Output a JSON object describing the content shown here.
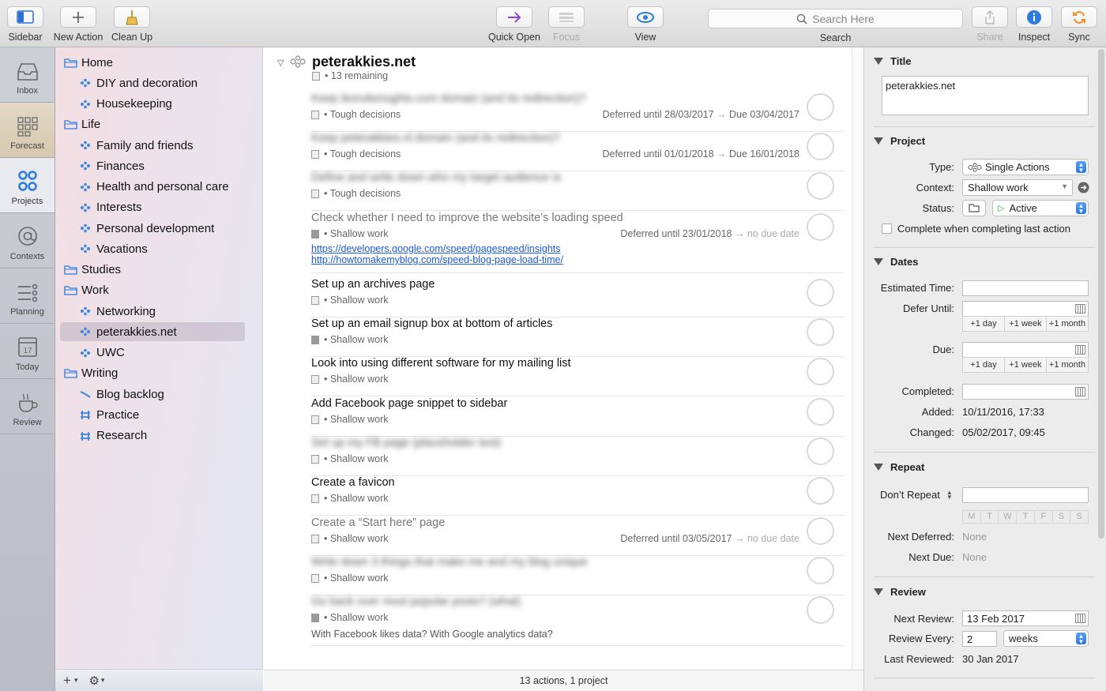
{
  "toolbar": {
    "sidebar": "Sidebar",
    "new_action": "New Action",
    "clean_up": "Clean Up",
    "quick_open": "Quick Open",
    "focus": "Focus",
    "view": "View",
    "search_placeholder": "Search Here",
    "search": "Search",
    "share": "Share",
    "inspect": "Inspect",
    "sync": "Sync"
  },
  "rail": [
    "Inbox",
    "Forecast",
    "Projects",
    "Contexts",
    "Planning",
    "Today",
    "Review"
  ],
  "today_day": "17",
  "sidebar": {
    "items": [
      {
        "label": "Home",
        "kind": "folder"
      },
      {
        "label": "DIY and decoration",
        "kind": "project"
      },
      {
        "label": "Housekeeping",
        "kind": "project"
      },
      {
        "label": "Life",
        "kind": "folder"
      },
      {
        "label": "Family and friends",
        "kind": "project"
      },
      {
        "label": "Finances",
        "kind": "project"
      },
      {
        "label": "Health and personal care",
        "kind": "project"
      },
      {
        "label": "Interests",
        "kind": "project"
      },
      {
        "label": "Personal development",
        "kind": "project"
      },
      {
        "label": "Vacations",
        "kind": "project"
      },
      {
        "label": "Studies",
        "kind": "folder"
      },
      {
        "label": "Work",
        "kind": "folder"
      },
      {
        "label": "Networking",
        "kind": "project"
      },
      {
        "label": "peterakkies.net",
        "kind": "project"
      },
      {
        "label": "UWC",
        "kind": "project"
      },
      {
        "label": "Writing",
        "kind": "folder"
      },
      {
        "label": "Blog backlog",
        "kind": "sequential"
      },
      {
        "label": "Practice",
        "kind": "parallel"
      },
      {
        "label": "Research",
        "kind": "parallel"
      }
    ],
    "bottom_add": "+",
    "bottom_gear": "⚙"
  },
  "project": {
    "title": "peterakkies.net",
    "remaining": "• 13 remaining"
  },
  "actions": [
    {
      "title": "Keep ikoruitonughts.com domain (and its redirection)?",
      "context": "• Tough decisions",
      "deferred": "Deferred until 28/03/2017",
      "due": "Due 03/04/2017"
    },
    {
      "title": "Keep peterakkies.nl domain (and its redirection)?",
      "context": "• Tough decisions",
      "deferred": "Deferred until 01/01/2018",
      "due": "Due 16/01/2018"
    },
    {
      "title": "Define and write down who my target audience is",
      "context": "• Tough decisions"
    },
    {
      "title": "Check whether I need to improve the website’s loading speed",
      "context": "• Shallow work",
      "deferred": "Deferred until 23/01/2018",
      "due": "no due date",
      "links": [
        "https://developers.google.com/speed/pagespeed/insights",
        "http://howtomakemyblog.com/speed-blog-page-load-time/"
      ]
    },
    {
      "title": "Set up an archives page",
      "context": "• Shallow work"
    },
    {
      "title": "Set up an email signup box at bottom of articles",
      "context": "• Shallow work"
    },
    {
      "title": "Look into using different software for my mailing list",
      "context": "• Shallow work"
    },
    {
      "title": "Add Facebook page snippet to sidebar",
      "context": "• Shallow work"
    },
    {
      "title": "Set up my FB page (placeholder text)",
      "context": "• Shallow work"
    },
    {
      "title": "Create a favicon",
      "context": "• Shallow work"
    },
    {
      "title": "Create a “Start here” page",
      "context": "• Shallow work",
      "deferred": "Deferred until 03/05/2017",
      "due": "no due date"
    },
    {
      "title": "Write down 3 things that make me and my blog unique",
      "context": "• Shallow work"
    },
    {
      "title": "Go back over most popular posts? (what)",
      "context": "• Shallow work",
      "note": "With Facebook likes data? With Google analytics data?"
    }
  ],
  "status_bar": "13 actions, 1 project",
  "inspector": {
    "title_section": "Title",
    "title_value": "peterakkies.net",
    "project_section": "Project",
    "type_label": "Type:",
    "type_value": "Single Actions",
    "context_label": "Context:",
    "context_value": "Shallow work",
    "status_label": "Status:",
    "status_value": "Active",
    "complete_checkbox": "Complete when completing last action",
    "dates_section": "Dates",
    "estimated_label": "Estimated Time:",
    "defer_label": "Defer Until:",
    "due_label": "Due:",
    "quick": [
      "+1 day",
      "+1 week",
      "+1 month"
    ],
    "completed_label": "Completed:",
    "added_label": "Added:",
    "added_value": "10/11/2016, 17:33",
    "changed_label": "Changed:",
    "changed_value": "05/02/2017, 09:45",
    "repeat_section": "Repeat",
    "repeat_value": "Don’t Repeat",
    "weekdays": [
      "M",
      "T",
      "W",
      "T",
      "F",
      "S",
      "S"
    ],
    "next_deferred_label": "Next Deferred:",
    "next_deferred_value": "None",
    "next_due_label": "Next Due:",
    "next_due_value": "None",
    "review_section": "Review",
    "next_review_label": "Next Review:",
    "next_review_value": "13 Feb 2017",
    "review_every_label": "Review Every:",
    "review_every_value": "2",
    "review_every_unit": "weeks",
    "last_reviewed_label": "Last Reviewed:",
    "last_reviewed_value": "30 Jan 2017"
  }
}
